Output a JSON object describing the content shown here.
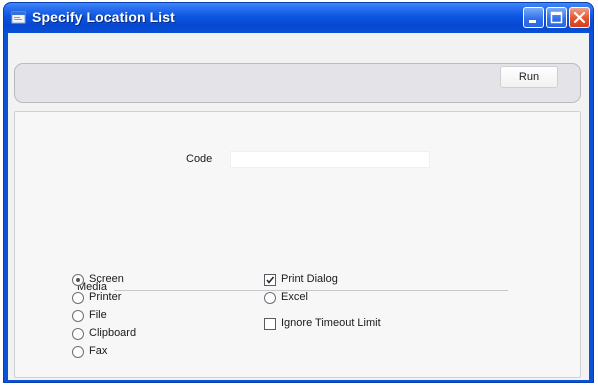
{
  "window": {
    "title": "Specify Location List",
    "buttons": {
      "minimize": "minimize-icon",
      "maximize": "maximize-icon",
      "close": "close-icon"
    }
  },
  "toolbar": {
    "run_label": "Run"
  },
  "form": {
    "code_label": "Code",
    "code_value": "",
    "media": {
      "label": "Media",
      "options": [
        {
          "label": "Screen",
          "selected": true
        },
        {
          "label": "Printer",
          "selected": false
        },
        {
          "label": "File",
          "selected": false
        },
        {
          "label": "Clipboard",
          "selected": false
        },
        {
          "label": "Fax",
          "selected": false
        }
      ],
      "second_column": [
        {
          "type": "checkbox",
          "label": "Print Dialog",
          "checked": true
        },
        {
          "type": "radio",
          "label": "Excel",
          "selected": false
        },
        {
          "type": "checkbox",
          "label": "Ignore Timeout Limit",
          "checked": false
        }
      ]
    }
  },
  "colors": {
    "titlebar": "#0b55e0",
    "close_button": "#d2401c",
    "client_bg": "#f2f2f2"
  }
}
